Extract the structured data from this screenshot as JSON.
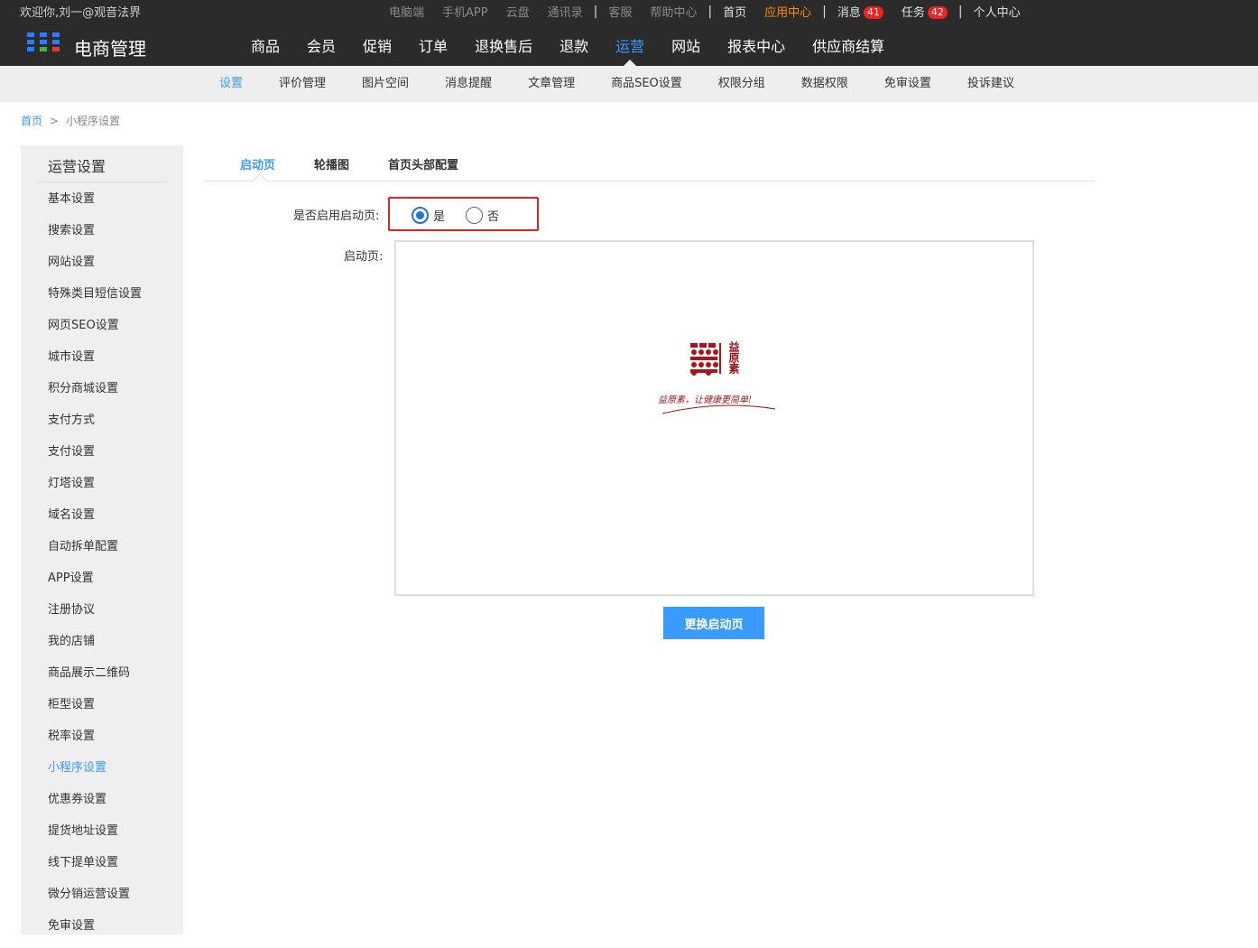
{
  "topbar": {
    "welcome": "欢迎你,刘一@观音法界",
    "links": [
      "电脑端",
      "手机APP",
      "云盘",
      "通讯录"
    ],
    "help_links": [
      "客服",
      "帮助中心"
    ],
    "home": "首页",
    "app_center": "应用中心",
    "messages_label": "消息",
    "messages_count": "41",
    "tasks_label": "任务",
    "tasks_count": "42",
    "personal": "个人中心"
  },
  "header": {
    "brand": "电商管理",
    "nav": [
      "商品",
      "会员",
      "促销",
      "订单",
      "退换售后",
      "退款",
      "运营",
      "网站",
      "报表中心",
      "供应商结算"
    ],
    "active_nav": "运营"
  },
  "subnav": {
    "items": [
      "设置",
      "评价管理",
      "图片空间",
      "消息提醒",
      "文章管理",
      "商品SEO设置",
      "权限分组",
      "数据权限",
      "免审设置",
      "投诉建议"
    ],
    "active": "设置"
  },
  "breadcrumb": {
    "home": "首页",
    "separator": ">",
    "current": "小程序设置"
  },
  "sidebar": {
    "title": "运营设置",
    "items": [
      "基本设置",
      "搜索设置",
      "网站设置",
      "特殊类目短信设置",
      "网页SEO设置",
      "城市设置",
      "积分商城设置",
      "支付方式",
      "支付设置",
      "灯塔设置",
      "域名设置",
      "自动拆单配置",
      "APP设置",
      "注册协议",
      "我的店铺",
      "商品展示二维码",
      "柜型设置",
      "税率设置",
      "小程序设置",
      "优惠券设置",
      "提货地址设置",
      "线下提单设置",
      "微分销运营设置",
      "免审设置"
    ],
    "active": "小程序设置"
  },
  "tabs": {
    "items": [
      "启动页",
      "轮播图",
      "首页头部配置"
    ],
    "active": "启动页"
  },
  "form": {
    "enable_label": "是否启用启动页:",
    "yes": "是",
    "no": "否",
    "selected": "是",
    "splash_label": "启动页:",
    "logo_text": "益原素",
    "logo_slogan": "益原素，让健康更简单!",
    "change_button": "更换启动页"
  },
  "colors": {
    "accent": "#3a9bff",
    "header_bg": "#2b2b2b",
    "highlight_border": "#e3231e",
    "logo_red": "#b4121a"
  }
}
